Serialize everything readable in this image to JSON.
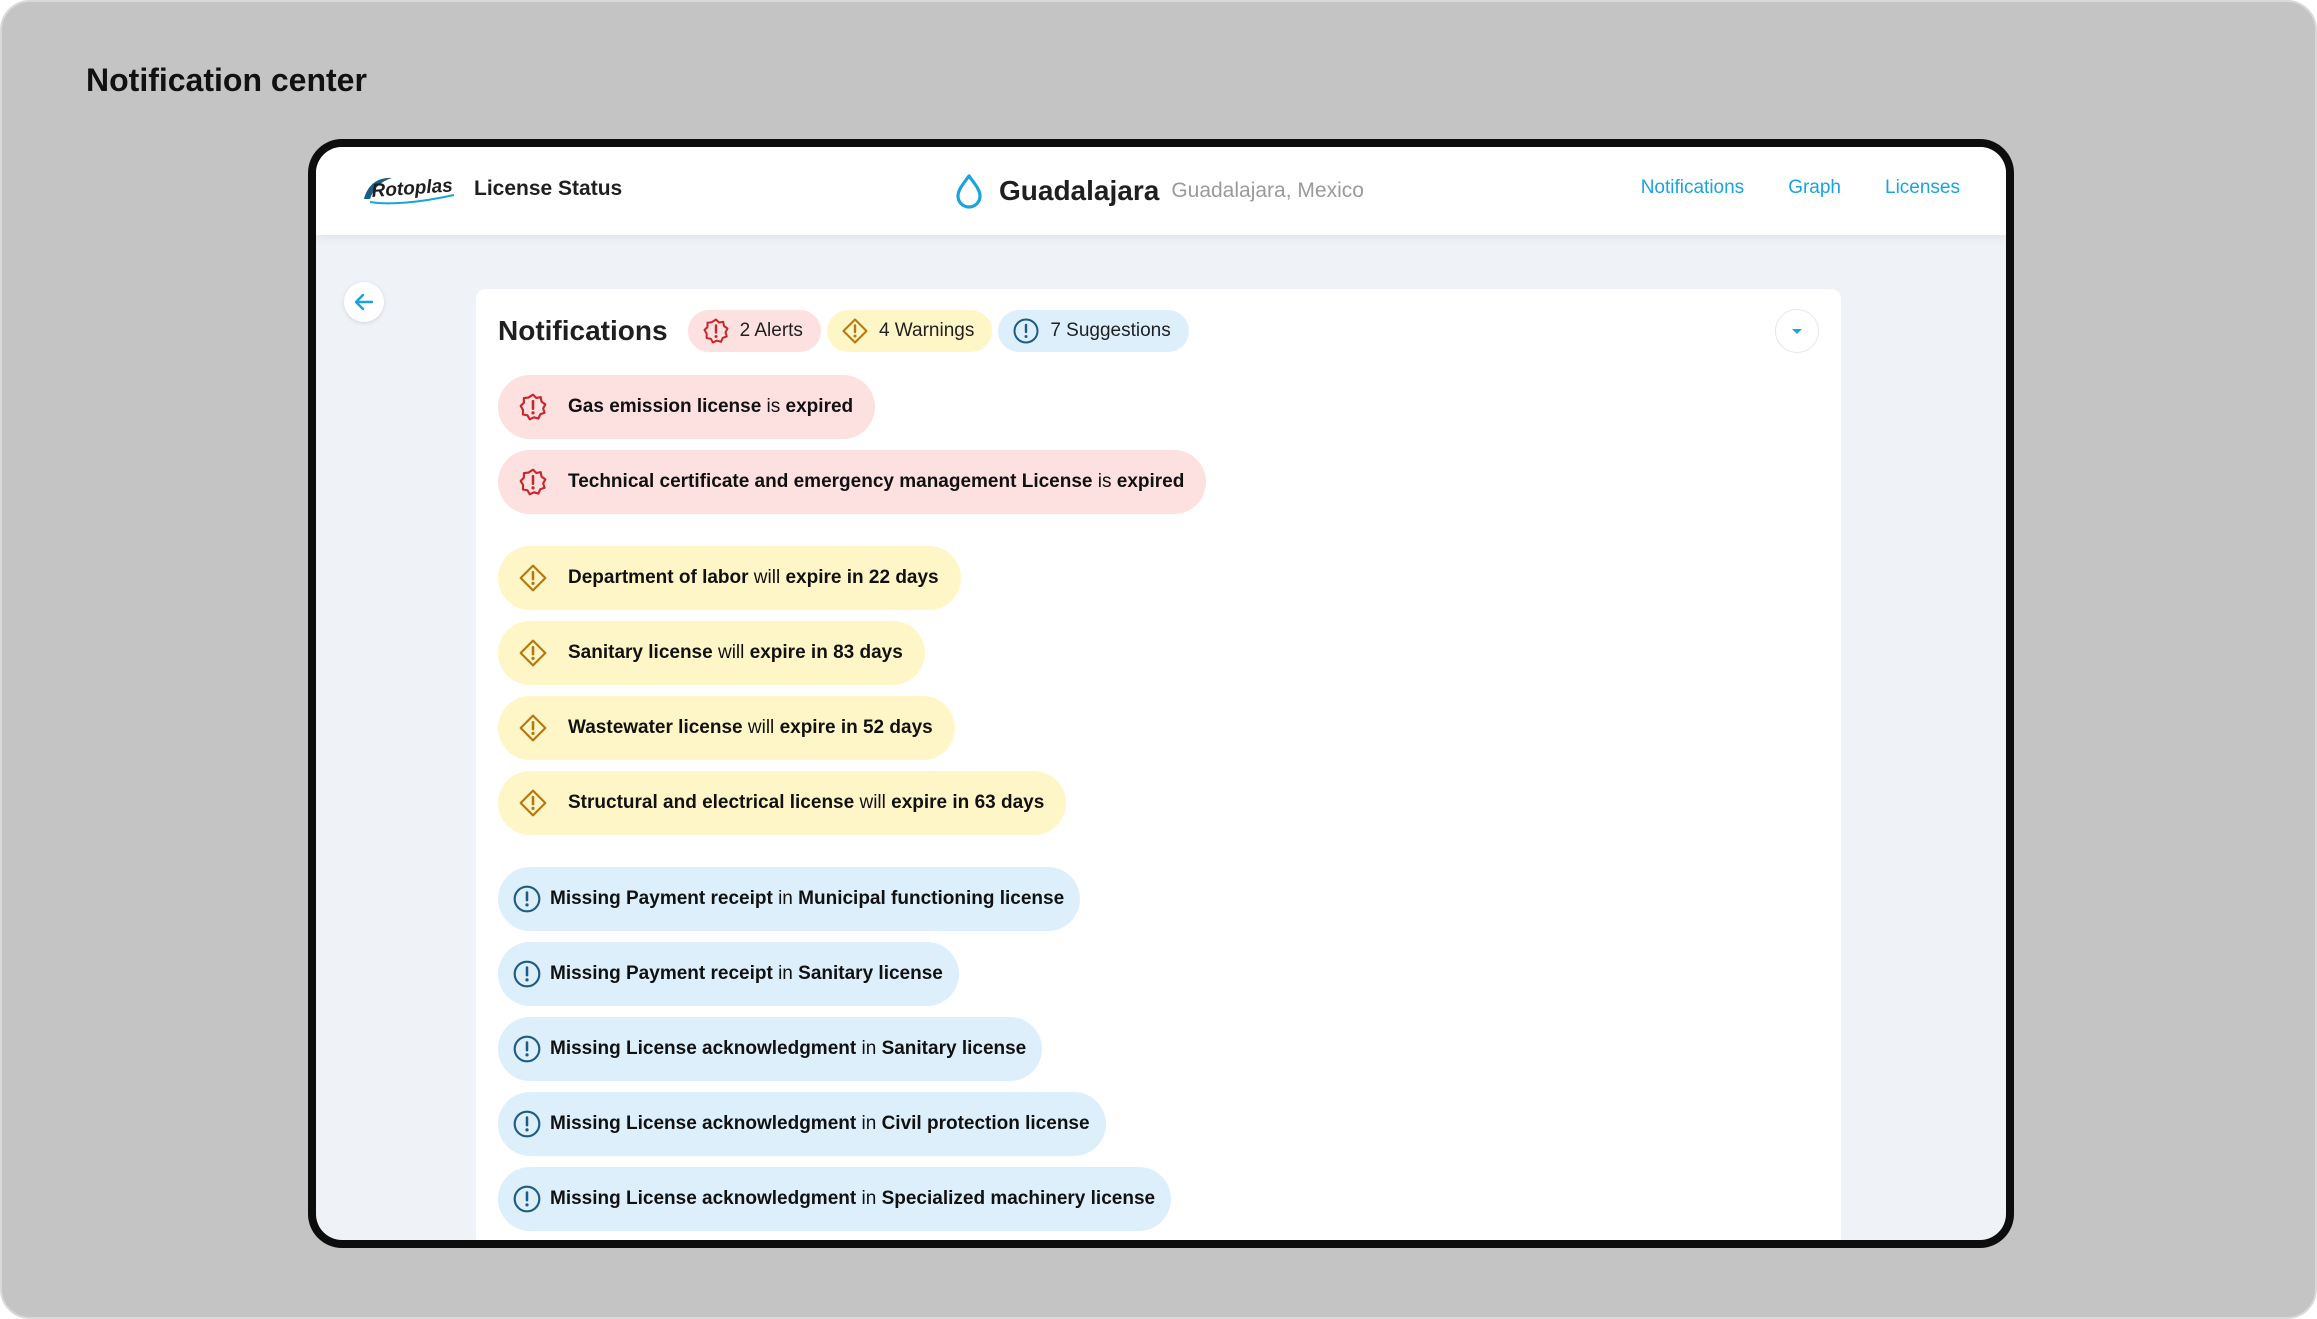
{
  "canvas_title": "Notification center",
  "header": {
    "logo_text": "Rotoplas",
    "title": "License Status",
    "location": {
      "city": "Guadalajara",
      "region": "Guadalajara, Mexico"
    },
    "nav": [
      {
        "label": "Notifications"
      },
      {
        "label": "Graph"
      },
      {
        "label": "Licenses"
      }
    ]
  },
  "colors": {
    "accent": "#1aa3dc",
    "alert_bg": "#fde0e0",
    "alert_icon": "#c8262b",
    "warning_bg": "#fff6c7",
    "warning_icon": "#b7770d",
    "suggestion_bg": "#deeffc",
    "suggestion_icon": "#1e5c86"
  },
  "panel": {
    "title": "Notifications",
    "chips": [
      {
        "type": "alert",
        "icon": "alert-badge-icon",
        "label": "2 Alerts"
      },
      {
        "type": "warning",
        "icon": "warning-diamond-icon",
        "label": "4 Warnings"
      },
      {
        "type": "suggestion",
        "icon": "info-circle-icon",
        "label": "7 Suggestions"
      }
    ]
  },
  "alerts": [
    {
      "subject": "Gas emission license",
      "verb": " is ",
      "status": "expired"
    },
    {
      "subject": "Technical certificate and emergency management License",
      "verb": " is ",
      "status": "expired"
    }
  ],
  "warnings": [
    {
      "subject": "Department of labor",
      "verb": " will ",
      "status": "expire in 22 days"
    },
    {
      "subject": "Sanitary license",
      "verb": " will ",
      "status": "expire in 83 days"
    },
    {
      "subject": "Wastewater license",
      "verb": " will ",
      "status": "expire in 52 days"
    },
    {
      "subject": "Structural and electrical license",
      "verb": " will ",
      "status": "expire in 63 days"
    }
  ],
  "suggestions": [
    {
      "subject": "Missing Payment receipt",
      "verb": " in ",
      "status": "Municipal functioning license"
    },
    {
      "subject": "Missing Payment receipt",
      "verb": " in ",
      "status": "Sanitary license"
    },
    {
      "subject": "Missing License acknowledgment",
      "verb": " in ",
      "status": "Sanitary license"
    },
    {
      "subject": "Missing License acknowledgment",
      "verb": " in ",
      "status": "Civil protection license"
    },
    {
      "subject": "Missing License acknowledgment",
      "verb": " in ",
      "status": "Specialized machinery license"
    }
  ]
}
